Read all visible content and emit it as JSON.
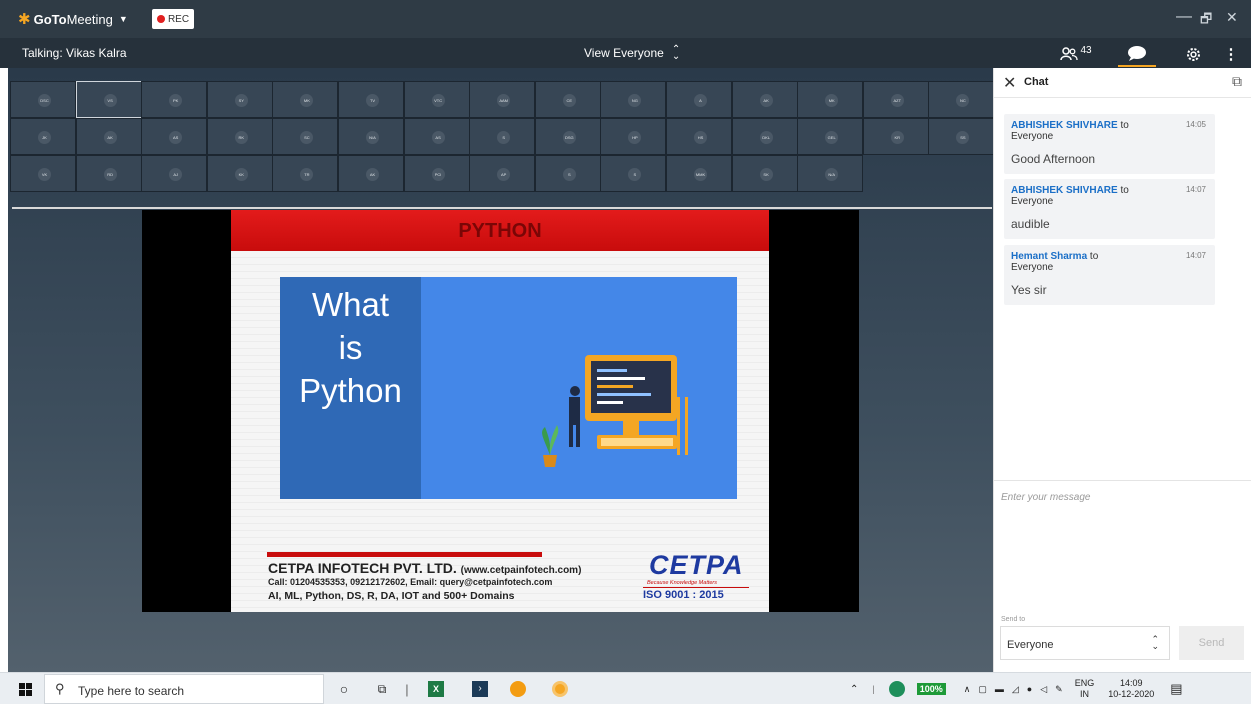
{
  "app": {
    "brand_bold": "GoTo",
    "brand_light": "Meeting",
    "rec_label": "REC"
  },
  "window_controls": [
    "—",
    "🗗",
    "✕"
  ],
  "infobar": {
    "talking": "Talking: Vikas Kalra",
    "view": "View Everyone",
    "attendee_count": "43"
  },
  "attendee_grid": {
    "rows": [
      [
        "DSC",
        "VS",
        "PK",
        "SY",
        "MK",
        "TV",
        "VTC",
        "AAM",
        "CE",
        "NG",
        "A",
        "AK",
        "MK",
        "AZT",
        "NC"
      ],
      [
        "JK",
        "AK",
        "AS",
        "RK",
        "SC",
        "N/A",
        "AS",
        "S",
        "DSG",
        "HP",
        "HS",
        "DKL",
        "GEL",
        "KR",
        "SS"
      ],
      [
        "VK",
        "RD",
        "AJ",
        "KK",
        "TR",
        "AK",
        "PCI",
        "AP",
        "S",
        "S",
        "MMK",
        "SK",
        "N/A"
      ]
    ],
    "selected_index": 1
  },
  "slide": {
    "banner": "PYTHON",
    "heading_lines": [
      "What",
      "is",
      "Python"
    ],
    "company": "CETPA INFOTECH PVT. LTD.",
    "company_url": "(www.cetpainfotech.com)",
    "contact": "Call: 01204535353, 09212172602, Email: query@cetpainfotech.com",
    "domains": "AI, ML, Python, DS, R, DA, IOT and 500+ Domains",
    "logo_text": "CETPA",
    "logo_tagline": "Because Knowledge Matters",
    "iso": "ISO 9001 : 2015"
  },
  "chat": {
    "title": "Chat",
    "messages": [
      {
        "sender": "ABHISHEK SHIVHARE",
        "to": " to",
        "recipient": "Everyone",
        "time": "14:05",
        "text": "Good Afternoon"
      },
      {
        "sender": "ABHISHEK SHIVHARE",
        "to": " to",
        "recipient": "Everyone",
        "time": "14:07",
        "text": "audible"
      },
      {
        "sender": "Hemant Sharma",
        "to": " to",
        "recipient": "Everyone",
        "time": "14:07",
        "text": "Yes sir"
      }
    ],
    "input_placeholder": "Enter your message",
    "send_to_label": "Send to",
    "send_to_value": "Everyone",
    "send_button": "Send"
  },
  "taskbar": {
    "search_placeholder": "Type here to search",
    "battery": "100%",
    "lang_top": "ENG",
    "lang_bottom": "IN",
    "time": "14:09",
    "date": "10-12-2020"
  }
}
